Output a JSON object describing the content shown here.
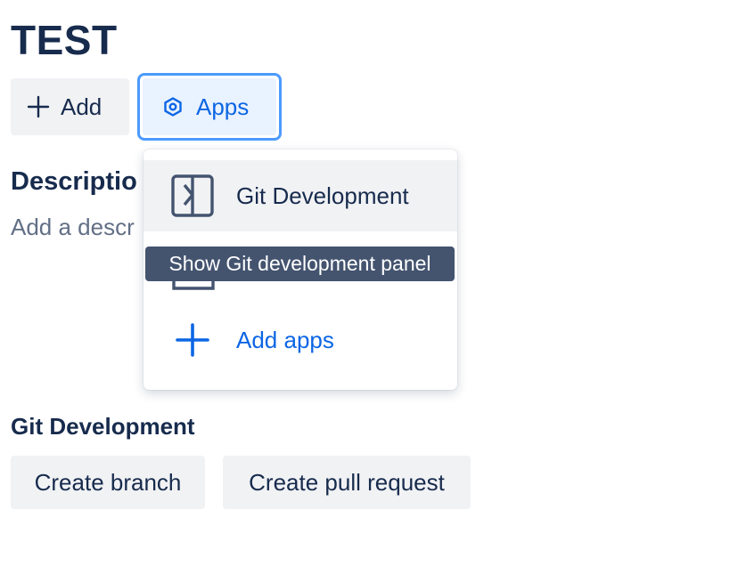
{
  "page": {
    "title": "TEST"
  },
  "toolbar": {
    "add_label": "Add",
    "apps_label": "Apps"
  },
  "description": {
    "heading": "Descriptio",
    "placeholder": "Add a descr"
  },
  "apps_menu": {
    "items": [
      {
        "label": "Git Development",
        "icon": "git-development-icon"
      },
      {
        "label": "Add apps",
        "icon": "plus-icon"
      }
    ]
  },
  "tooltip": {
    "text": "Show Git development panel"
  },
  "git_development": {
    "heading": "Git Development",
    "create_branch_label": "Create branch",
    "create_pr_label": "Create pull request"
  },
  "colors": {
    "text": "#172b4d",
    "subtle_text": "#626f86",
    "accent": "#0c66e4",
    "focus_ring": "#4c9aff",
    "button_bg": "#f1f2f4",
    "selected_bg": "#e9f2ff",
    "tooltip_bg": "#44546f"
  }
}
